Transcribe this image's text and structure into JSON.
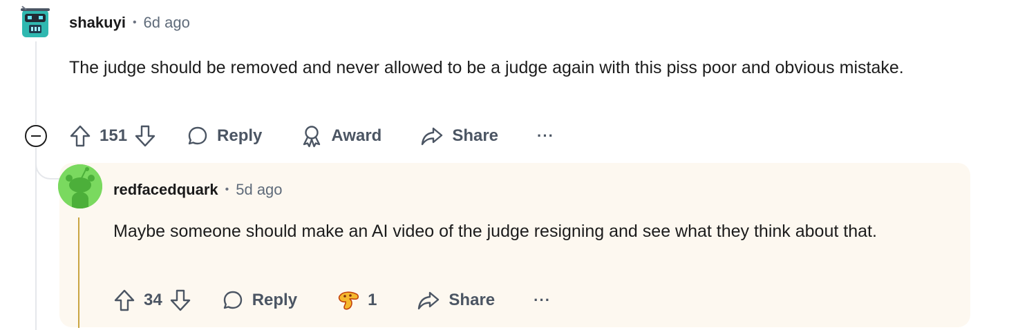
{
  "comment": {
    "username": "shakuyi",
    "separator": "•",
    "time": "6d ago",
    "body": "The judge should be removed and never allowed to be a judge again with this piss poor and obvious mistake.",
    "actions": {
      "score": "151",
      "reply_label": "Reply",
      "award_label": "Award",
      "share_label": "Share",
      "more_label": "···"
    }
  },
  "reply": {
    "username": "redfacedquark",
    "separator": "•",
    "time": "5d ago",
    "body": "Maybe someone should make an AI video of the judge resigning and see what they think about that.",
    "actions": {
      "score": "34",
      "reply_label": "Reply",
      "award_count": "1",
      "share_label": "Share",
      "more_label": "···"
    }
  },
  "colors": {
    "highlight_bg": "#fdf8f0",
    "highlight_bar": "#c9a441",
    "thread_line": "#e5e7eb",
    "avatar_green": "#7ad95f"
  },
  "icons": [
    "upvote-icon",
    "downvote-icon",
    "comment-bubble-icon",
    "award-icon",
    "share-arrow-icon",
    "more-icon",
    "collapse-icon",
    "award-emoji-icon"
  ]
}
